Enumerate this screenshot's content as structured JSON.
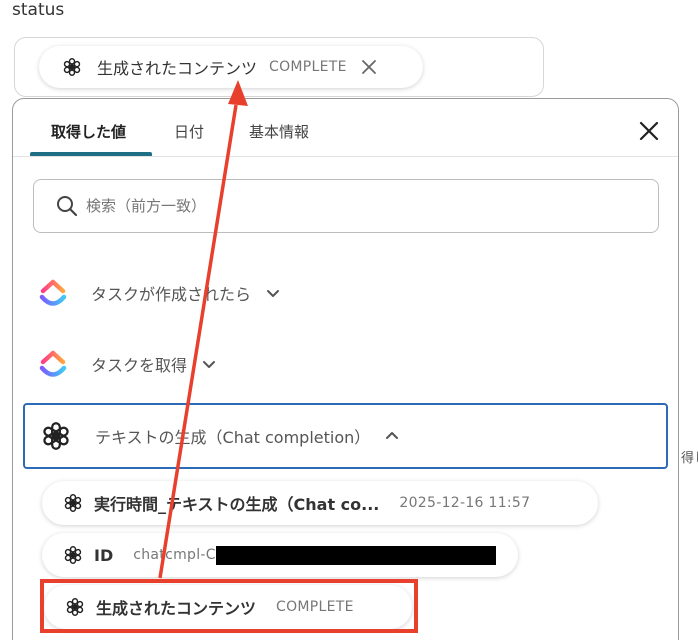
{
  "field": {
    "label": "status"
  },
  "selected_chip": {
    "icon": "openai-icon",
    "label": "生成されたコンテンツ",
    "status": "COMPLETE"
  },
  "panel": {
    "tabs": [
      {
        "label": "取得した値",
        "active": true
      },
      {
        "label": "日付",
        "active": false
      },
      {
        "label": "基本情報",
        "active": false
      }
    ],
    "search": {
      "placeholder": "検索（前方一致）",
      "value": ""
    },
    "groups": [
      {
        "icon": "clickup-icon",
        "label": "タスクが作成されたら",
        "expanded": false
      },
      {
        "icon": "clickup-icon",
        "label": "タスクを取得",
        "expanded": false
      },
      {
        "icon": "openai-icon",
        "label": "テキストの生成（Chat completion）",
        "expanded": true
      }
    ],
    "items": [
      {
        "icon": "openai-icon",
        "label": "実行時間_テキストの生成（Chat co...",
        "value": "2025-12-16 11:57"
      },
      {
        "icon": "openai-icon",
        "label": "ID",
        "value": "chatcmpl-C"
      },
      {
        "icon": "openai-icon",
        "label": "生成されたコンテンツ",
        "value": "COMPLETE"
      }
    ]
  },
  "outside_text": "得し",
  "colors": {
    "accent": "#1e6f83",
    "selected_border": "#2d6ab7",
    "annotation": "#e8402d",
    "redaction": "#000000"
  }
}
